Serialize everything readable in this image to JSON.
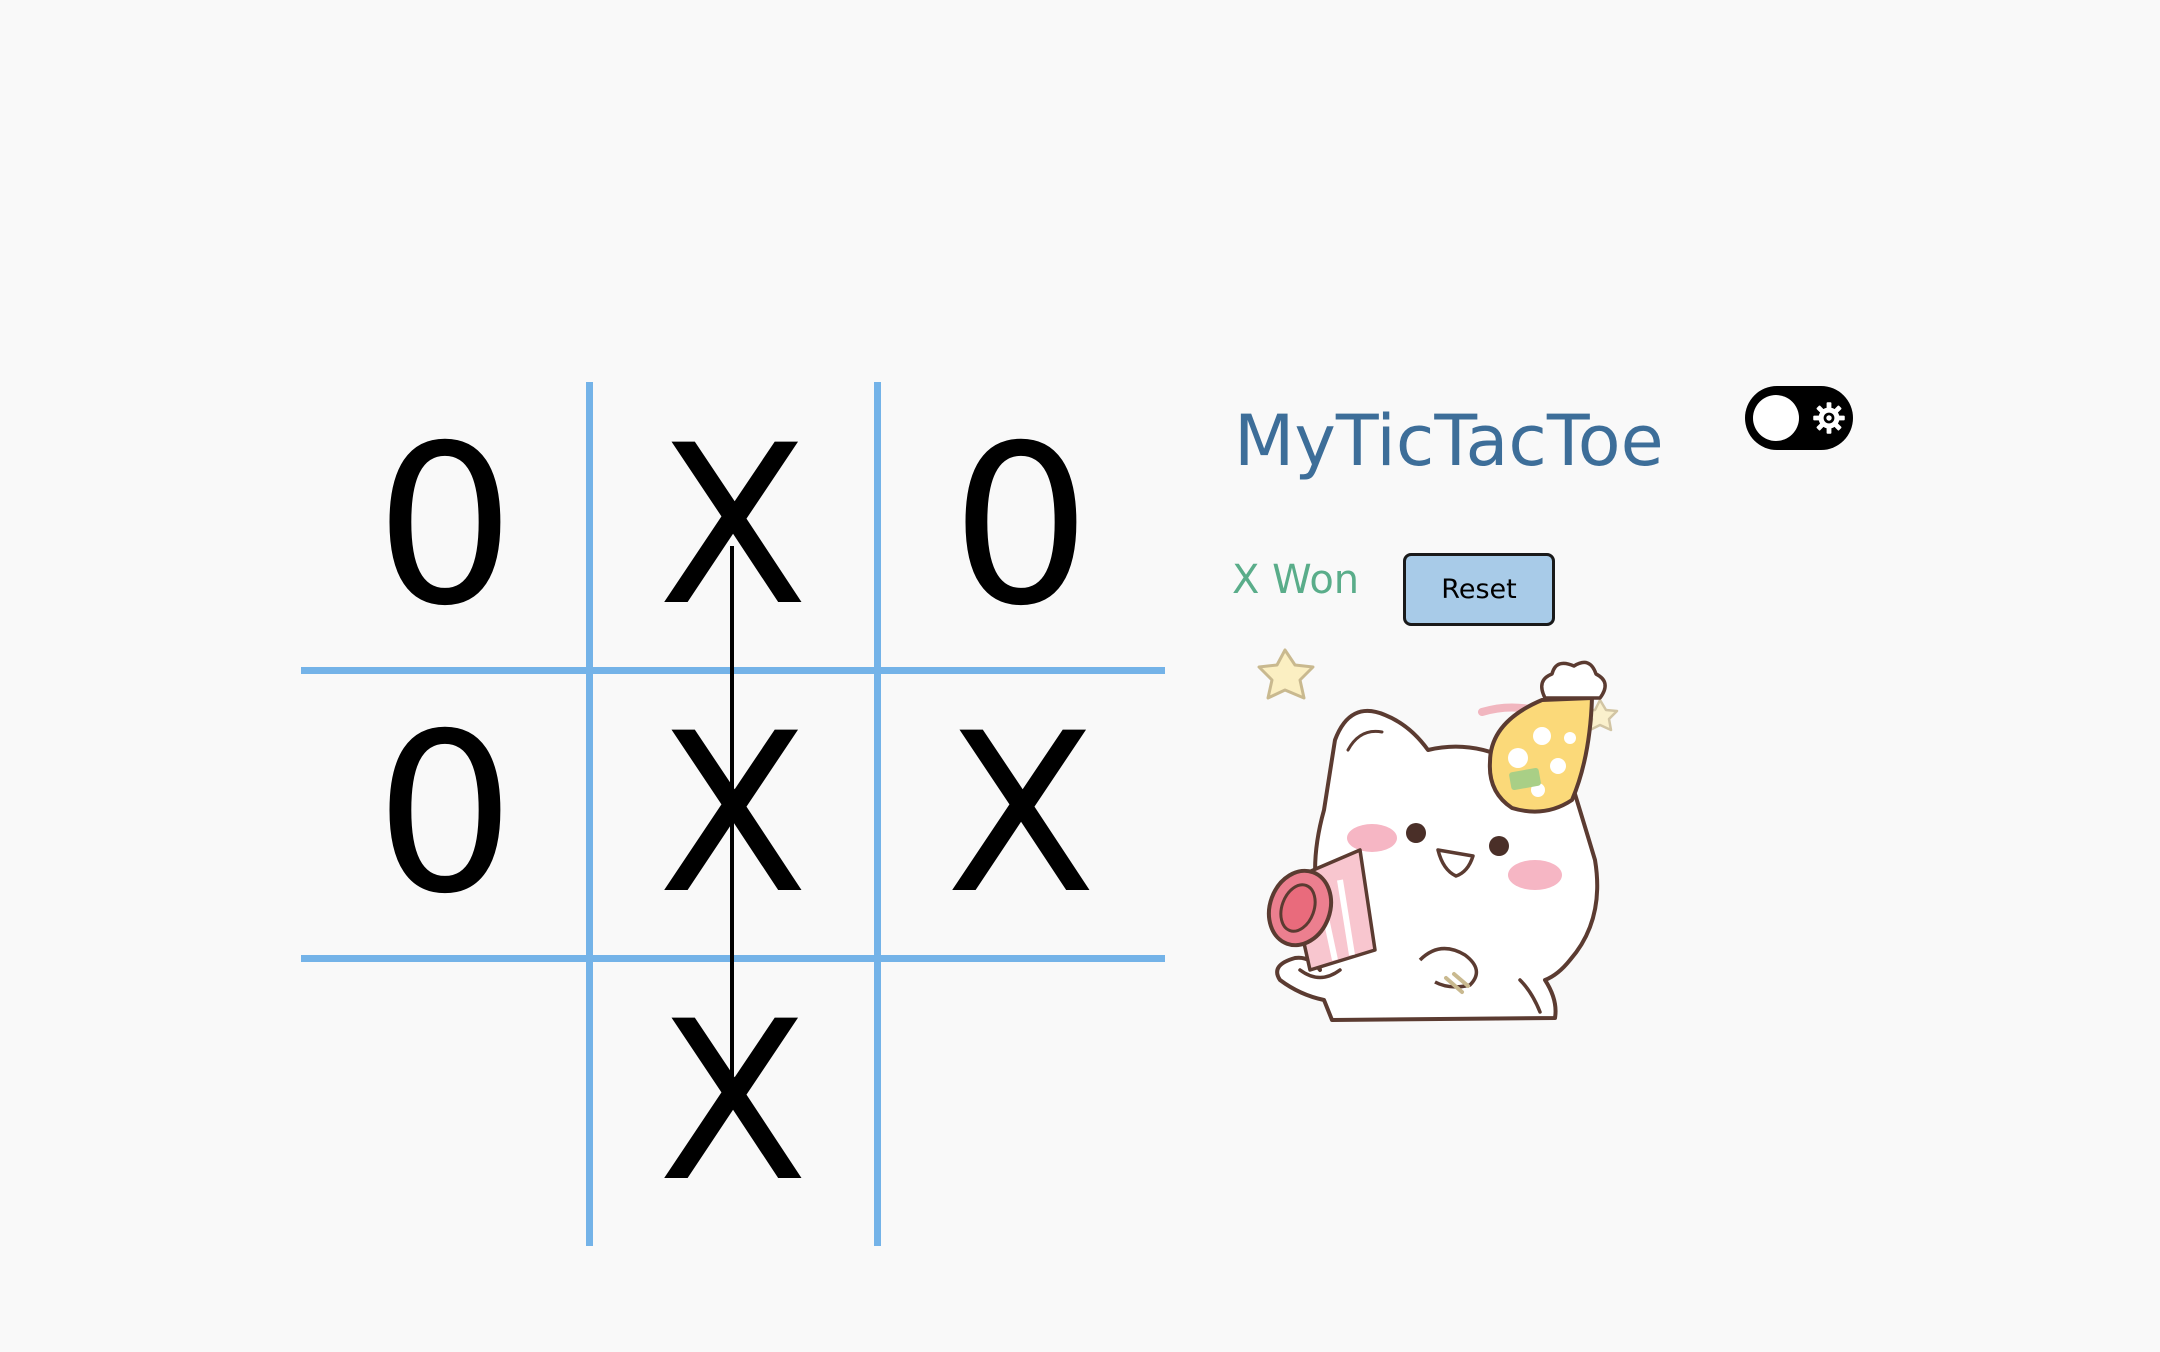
{
  "app": {
    "title": "MyTicTacToe"
  },
  "theme_toggle": {
    "state": "off",
    "icon": "gear-icon"
  },
  "status": {
    "text": "X Won"
  },
  "controls": {
    "reset_label": "Reset"
  },
  "board": {
    "cells": [
      "0",
      "X",
      "0",
      "0",
      "X",
      "X",
      "",
      "X",
      ""
    ],
    "winning_line": "middle-column",
    "winner": "X"
  },
  "colors": {
    "background": "#f9f9f9",
    "grid_line": "#74b3e8",
    "title": "#3d6e99",
    "status": "#5aad8a",
    "reset_button": "#a8cbe8",
    "toggle": "#000000"
  },
  "illustration": {
    "icon": "party-cat-illustration"
  }
}
